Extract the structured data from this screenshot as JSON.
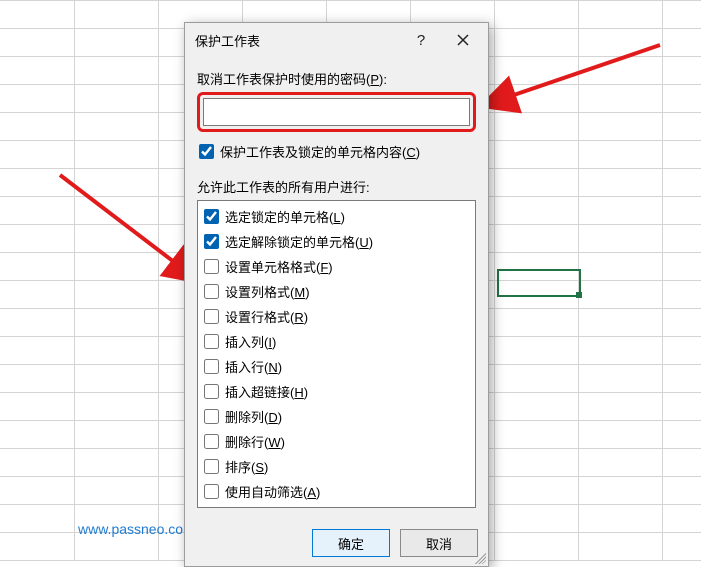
{
  "dialog": {
    "title": "保护工作表",
    "password_label": "取消工作表保护时使用的密码(",
    "password_hotkey": "P",
    "password_label_end": "):",
    "password_value": "",
    "protect_contents_label": "保护工作表及锁定的单元格内容(",
    "protect_contents_hotkey": "C",
    "protect_contents_end": ")",
    "protect_contents_checked": true,
    "allow_label": "允许此工作表的所有用户进行:",
    "options": [
      {
        "key": "select-locked",
        "label": "选定锁定的单元格(",
        "hotkey": "L",
        "end": ")",
        "checked": true
      },
      {
        "key": "select-unlocked",
        "label": "选定解除锁定的单元格(",
        "hotkey": "U",
        "end": ")",
        "checked": true
      },
      {
        "key": "format-cells",
        "label": "设置单元格格式(",
        "hotkey": "F",
        "end": ")",
        "checked": false
      },
      {
        "key": "format-columns",
        "label": "设置列格式(",
        "hotkey": "M",
        "end": ")",
        "checked": false
      },
      {
        "key": "format-rows",
        "label": "设置行格式(",
        "hotkey": "R",
        "end": ")",
        "checked": false
      },
      {
        "key": "insert-columns",
        "label": "插入列(",
        "hotkey": "I",
        "end": ")",
        "checked": false
      },
      {
        "key": "insert-rows",
        "label": "插入行(",
        "hotkey": "N",
        "end": ")",
        "checked": false
      },
      {
        "key": "insert-hyperlinks",
        "label": "插入超链接(",
        "hotkey": "H",
        "end": ")",
        "checked": false
      },
      {
        "key": "delete-columns",
        "label": "删除列(",
        "hotkey": "D",
        "end": ")",
        "checked": false
      },
      {
        "key": "delete-rows",
        "label": "删除行(",
        "hotkey": "W",
        "end": ")",
        "checked": false
      },
      {
        "key": "sort",
        "label": "排序(",
        "hotkey": "S",
        "end": ")",
        "checked": false
      },
      {
        "key": "autofilter",
        "label": "使用自动筛选(",
        "hotkey": "A",
        "end": ")",
        "checked": false
      }
    ],
    "ok_label": "确定",
    "cancel_label": "取消"
  },
  "watermark": "www.passneo.com"
}
